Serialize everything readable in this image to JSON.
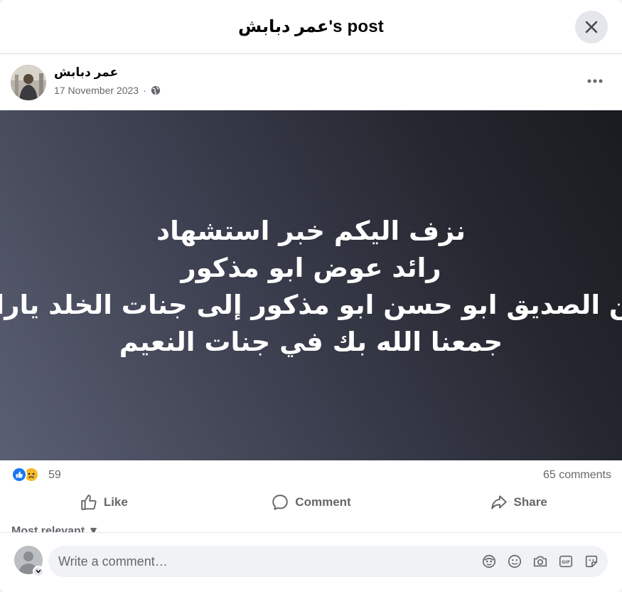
{
  "header": {
    "title": "عمر دبابش's post"
  },
  "post": {
    "author": "عمر دبابش",
    "date": "17 November 2023",
    "separator": "·",
    "text_lines": [
      "نزف اليكم خبر استشهاد",
      "رائد عوض ابو مذكور",
      "ابن الصديق ابو حسن ابو مذكور إلى جنات الخلد يارائد",
      "جمعنا الله بك في جنات النعيم"
    ]
  },
  "stats": {
    "reaction_count": "59",
    "comments": "65 comments"
  },
  "actions": {
    "like": "Like",
    "comment": "Comment",
    "share": "Share"
  },
  "sort": {
    "label": "Most relevant"
  },
  "composer": {
    "placeholder": "Write a comment…"
  },
  "colors": {
    "accent": "#1877f2",
    "secondary_text": "#65676b",
    "button_bg": "#e4e6eb"
  }
}
